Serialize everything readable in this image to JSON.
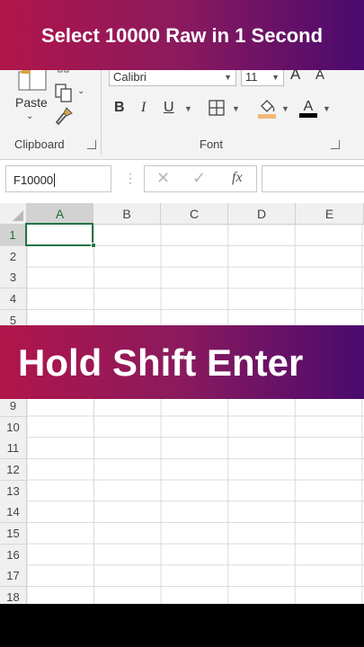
{
  "overlay": {
    "top_caption": "Select 10000 Raw in 1 Second",
    "middle_caption": "Hold Shift Enter"
  },
  "ribbon": {
    "clipboard": {
      "paste_label": "Paste",
      "group_label": "Clipboard"
    },
    "font": {
      "group_label": "Font",
      "font_name": "Calibri",
      "font_size": "11",
      "bold": "B",
      "italic": "I",
      "underline": "U",
      "grow_font": "A",
      "shrink_font": "A",
      "font_color_glyph": "A"
    },
    "colors": {
      "fill": "#f2b97a",
      "font_color": "#000000"
    }
  },
  "formula_bar": {
    "name_box_value": "F10000",
    "cancel_glyph": "✕",
    "enter_glyph": "✓",
    "insert_function_glyph": "fx",
    "formula_value": ""
  },
  "grid": {
    "columns": [
      "A",
      "B",
      "C",
      "D",
      "E"
    ],
    "rows_top": [
      "1",
      "2",
      "3",
      "4",
      "5"
    ],
    "rows_bottom": [
      "9",
      "10",
      "11",
      "12",
      "13",
      "14",
      "15",
      "16",
      "17",
      "18"
    ],
    "active_cell": "A1",
    "accent": "#217346"
  }
}
